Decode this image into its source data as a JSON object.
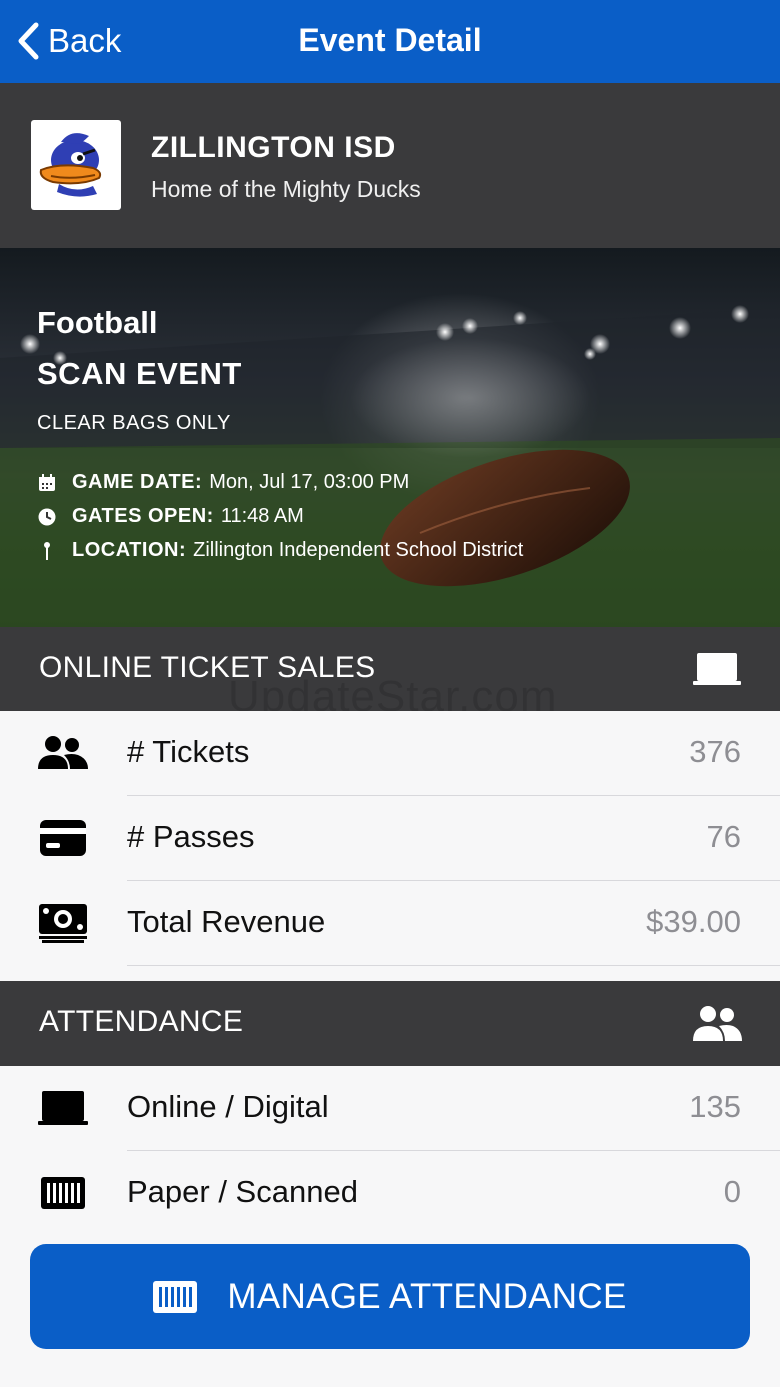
{
  "nav": {
    "back_label": "Back",
    "title": "Event Detail"
  },
  "org": {
    "name": "ZILLINGTON ISD",
    "subtitle": "Home of the Mighty Ducks"
  },
  "event": {
    "sport": "Football",
    "type": "SCAN EVENT",
    "note": "CLEAR BAGS ONLY",
    "game_date_label": "GAME DATE:",
    "game_date_value": "Mon, Jul 17, 03:00 PM",
    "gates_open_label": "GATES OPEN:",
    "gates_open_value": "11:48 AM",
    "location_label": "LOCATION:",
    "location_value": "Zillington Independent School District"
  },
  "online_sales": {
    "title": "ONLINE TICKET SALES",
    "rows": [
      {
        "label": "# Tickets",
        "value": "376",
        "icon": "users-icon"
      },
      {
        "label": "# Passes",
        "value": "76",
        "icon": "card-icon"
      },
      {
        "label": "Total Revenue",
        "value": "$39.00",
        "icon": "money-icon"
      }
    ]
  },
  "attendance": {
    "title": "ATTENDANCE",
    "rows": [
      {
        "label": "Online / Digital",
        "value": "135",
        "icon": "laptop-icon"
      },
      {
        "label": "Paper / Scanned",
        "value": "0",
        "icon": "barcode-icon"
      }
    ]
  },
  "watermark": "UpdateStar.com",
  "manage_button": {
    "label": "MANAGE ATTENDANCE",
    "icon": "barcode-icon"
  },
  "colors": {
    "primary": "#0a5ec7",
    "header_dark": "#3a3a3c",
    "value_gray": "#8e8e93"
  }
}
